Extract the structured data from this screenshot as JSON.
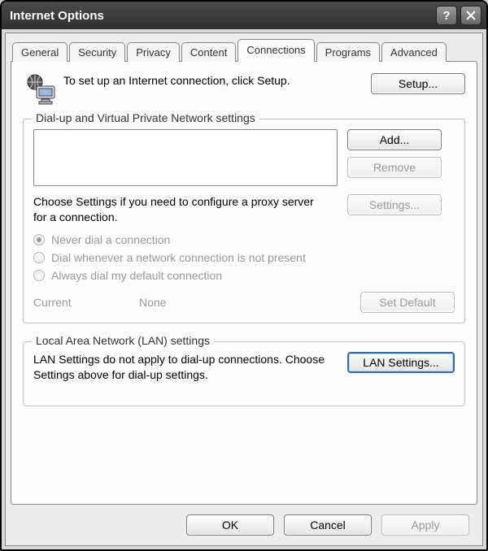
{
  "window": {
    "title": "Internet Options"
  },
  "tabs": {
    "general": "General",
    "security": "Security",
    "privacy": "Privacy",
    "content": "Content",
    "connections": "Connections",
    "programs": "Programs",
    "advanced": "Advanced"
  },
  "intro": {
    "text": "To set up an Internet connection, click Setup.",
    "setup_label": "Setup..."
  },
  "dialup_group": {
    "legend": "Dial-up and Virtual Private Network settings",
    "add_label": "Add...",
    "remove_label": "Remove",
    "settings_label": "Settings...",
    "choose_text": "Choose Settings if you need to configure a proxy server for a connection.",
    "radio_never": "Never dial a connection",
    "radio_whenever": "Dial whenever a network connection is not present",
    "radio_always": "Always dial my default connection",
    "current_label": "Current",
    "current_value": "None",
    "setdefault_label": "Set Default"
  },
  "lan_group": {
    "legend": "Local Area Network (LAN) settings",
    "text": "LAN Settings do not apply to dial-up connections. Choose Settings above for dial-up settings.",
    "lan_settings_label": "LAN Settings..."
  },
  "dlg_buttons": {
    "ok": "OK",
    "cancel": "Cancel",
    "apply": "Apply"
  }
}
